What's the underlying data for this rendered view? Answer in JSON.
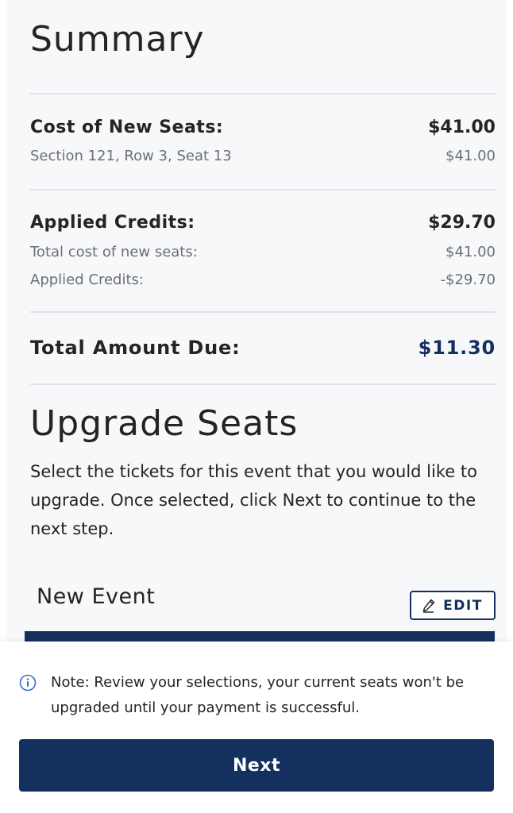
{
  "summary": {
    "title": "Summary",
    "cost_new_seats": {
      "label": "Cost of New Seats:",
      "amount": "$41.00",
      "detail_label": "Section 121, Row 3, Seat 13",
      "detail_amount": "$41.00"
    },
    "applied_credits": {
      "label": "Applied Credits:",
      "amount": "$29.70",
      "lines": [
        {
          "label": "Total cost of new seats:",
          "amount": "$41.00"
        },
        {
          "label": "Applied Credits:",
          "amount": "-$29.70"
        }
      ]
    },
    "total": {
      "label": "Total Amount Due:",
      "amount": "$11.30"
    }
  },
  "upgrade": {
    "title": "Upgrade Seats",
    "description_lines": [
      "Select the tickets for this event that you would like to",
      "upgrade. Once selected, click Next to continue to the",
      "next step."
    ],
    "event_title": "New Event",
    "edit_label": "EDIT"
  },
  "footer": {
    "note_lines": [
      "Note: Review your selections, your current seats won't be",
      "upgraded until your payment is successful."
    ],
    "next_label": "Next"
  },
  "icons": {
    "edit": "pencil-icon",
    "note": "info-icon"
  },
  "colors": {
    "brand_navy": "#14305e",
    "panel_bg": "#f7f8fa",
    "muted_text": "#6b6f74"
  }
}
